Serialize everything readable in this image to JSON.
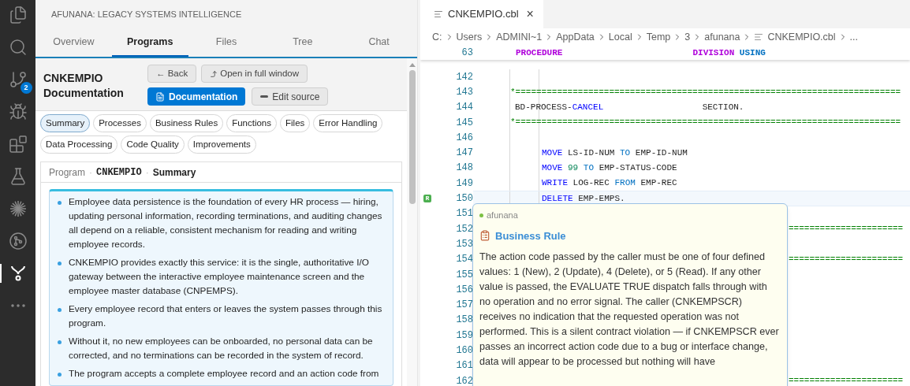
{
  "activity_bar": {
    "items": [
      {
        "kind": "files",
        "selected": false
      },
      {
        "kind": "search",
        "selected": false
      },
      {
        "kind": "scm",
        "selected": false,
        "badge": "2"
      },
      {
        "kind": "debug",
        "selected": false
      },
      {
        "kind": "extensions",
        "selected": false
      },
      {
        "kind": "testing",
        "selected": false
      },
      {
        "kind": "burst",
        "selected": false
      },
      {
        "kind": "graph",
        "selected": false
      },
      {
        "kind": "fork",
        "selected": true
      },
      {
        "kind": "more",
        "selected": false
      }
    ]
  },
  "panel": {
    "title": "AFUNANA: LEGACY SYSTEMS INTELLIGENCE",
    "tabs": [
      {
        "label": "Overview",
        "selected": false
      },
      {
        "label": "Programs",
        "selected": true
      },
      {
        "label": "Files",
        "selected": false
      },
      {
        "label": "Tree",
        "selected": false
      },
      {
        "label": "Chat",
        "selected": false
      }
    ],
    "doc_title": "CNKEMPIO Documentation",
    "actions": [
      {
        "label": "← Back",
        "kind": "back"
      },
      {
        "label": "Open in full window",
        "kind": "open"
      }
    ],
    "views": [
      {
        "label": "Documentation",
        "kind": "doc",
        "selected": true
      },
      {
        "label": "Edit source",
        "kind": "edit",
        "selected": false
      }
    ],
    "sections": [
      {
        "label": "Summary",
        "selected": true
      },
      {
        "label": "Processes",
        "selected": false
      },
      {
        "label": "Business Rules",
        "selected": false
      },
      {
        "label": "Functions",
        "selected": false
      },
      {
        "label": "Files",
        "selected": false
      },
      {
        "label": "Error Handling",
        "selected": false
      },
      {
        "label": "Data Processing",
        "selected": false
      },
      {
        "label": "Code Quality",
        "selected": false
      },
      {
        "label": "Improvements",
        "selected": false
      }
    ],
    "breadcrumb": [
      {
        "text": "Program",
        "kind": "root"
      },
      {
        "text": "·",
        "kind": "sep"
      },
      {
        "text": "CNKEMPIO",
        "kind": "code"
      },
      {
        "text": "·",
        "kind": "sep"
      },
      {
        "text": "Summary",
        "kind": "current"
      }
    ],
    "bullets": [
      "Employee data persistence is the foundation of every HR process — hiring, updating personal information, recording terminations, and auditing changes all depend on a reliable, consistent mechanism for reading and writing employee records.",
      "CNKEMPIO provides exactly this service: it is the single, authoritative I/O gateway between the interactive employee maintenance screen and the employee master database (CNPEMPS).",
      "Every employee record that enters or leaves the system passes through this program.",
      "Without it, no new employees can be onboarded, no personal data can be corrected, and no terminations can be recorded in the system of record.",
      "The program accepts a complete employee record and an action code from"
    ]
  },
  "editor": {
    "tab": {
      "label": "CNKEMPIO.cbl",
      "close": "×"
    },
    "path": [
      "C:",
      "Users",
      "ADMINI~1",
      "AppData",
      "Local",
      "Temp",
      "3",
      "afunana",
      "CNKEMPIO.cbl",
      "..."
    ],
    "sticky": {
      "number": "63",
      "tokens": [
        {
          "text": "PROCEDURE",
          "kind": "division"
        },
        {
          "text": "                         DIVISION",
          "kind": "division"
        },
        {
          "text": " USING",
          "kind": "operator"
        }
      ]
    },
    "lines": [
      {
        "number": "142",
        "kind": "blank",
        "current": false
      },
      {
        "number": "143",
        "kind": "comment",
        "current": false,
        "tokens": [
          {
            "text": "*==========================================================================",
            "kind": "comment"
          }
        ]
      },
      {
        "number": "144",
        "kind": "section",
        "current": false,
        "tokens": [
          {
            "text": "BD-PROCESS-",
            "kind": "plain"
          },
          {
            "text": "CANCEL",
            "kind": "keyword"
          },
          {
            "text": "                   SECTION.",
            "kind": "plain"
          }
        ]
      },
      {
        "number": "145",
        "kind": "comment",
        "current": false,
        "tokens": [
          {
            "text": "*==========================================================================",
            "kind": "comment"
          }
        ]
      },
      {
        "number": "146",
        "kind": "blank",
        "current": false
      },
      {
        "number": "147",
        "kind": "statement",
        "current": false,
        "tokens": [
          {
            "text": "MOVE",
            "kind": "keyword"
          },
          {
            "text": " LS-ID-NUM",
            "kind": "plain"
          },
          {
            "text": " TO",
            "kind": "operator"
          },
          {
            "text": " EMP-ID-NUM",
            "kind": "plain"
          }
        ]
      },
      {
        "number": "148",
        "kind": "statement",
        "current": false,
        "tokens": [
          {
            "text": "MOVE",
            "kind": "keyword"
          },
          {
            "text": " 99",
            "kind": "number"
          },
          {
            "text": " TO",
            "kind": "operator"
          },
          {
            "text": " EMP-STATUS-CODE",
            "kind": "plain"
          }
        ]
      },
      {
        "number": "149",
        "kind": "statement",
        "current": false,
        "tokens": [
          {
            "text": "WRITE",
            "kind": "keyword"
          },
          {
            "text": " LOG-REC",
            "kind": "plain"
          },
          {
            "text": " FROM",
            "kind": "operator"
          },
          {
            "text": " EMP-REC",
            "kind": "plain"
          }
        ]
      },
      {
        "number": "150",
        "kind": "statement",
        "current": true,
        "marker": "R",
        "tokens": [
          {
            "text": "DELETE",
            "kind": "keyword"
          },
          {
            "text": " EMP-EMPS.",
            "kind": "plain"
          }
        ]
      },
      {
        "number": "151",
        "kind": "blank",
        "current": false
      },
      {
        "number": "152",
        "kind": "partial",
        "current": false,
        "tokens": [
          {
            "text": "======================",
            "kind": "comment"
          }
        ]
      },
      {
        "number": "153",
        "kind": "blank",
        "current": false
      },
      {
        "number": "154",
        "kind": "partial",
        "current": false,
        "tokens": [
          {
            "text": "======================",
            "kind": "comment"
          }
        ]
      },
      {
        "number": "155",
        "kind": "blank",
        "current": false
      },
      {
        "number": "156",
        "kind": "blank",
        "current": false
      },
      {
        "number": "157",
        "kind": "blank",
        "current": false
      },
      {
        "number": "158",
        "kind": "blank",
        "current": false
      },
      {
        "number": "159",
        "kind": "blank",
        "current": false
      },
      {
        "number": "160",
        "kind": "blank",
        "current": false
      },
      {
        "number": "161",
        "kind": "blank",
        "current": false
      },
      {
        "number": "162",
        "kind": "partial",
        "current": false,
        "tokens": [
          {
            "text": "======================",
            "kind": "comment"
          }
        ]
      }
    ],
    "hover": {
      "source": "afunana",
      "title": "Business Rule",
      "text": "The action code passed by the caller must be one of four defined values: 1 (New), 2 (Update), 4 (Delete), or 5 (Read). If any other value is passed, the EVALUATE TRUE dispatch falls through with no operation and no error signal. The caller (CNKEMPSCR) receives no indication that the requested operation was not performed. This is a silent contract violation — if CNKEMPSCR ever passes an incorrect action code due to a bug or interface change, data will appear to be processed but nothing will have"
    }
  }
}
